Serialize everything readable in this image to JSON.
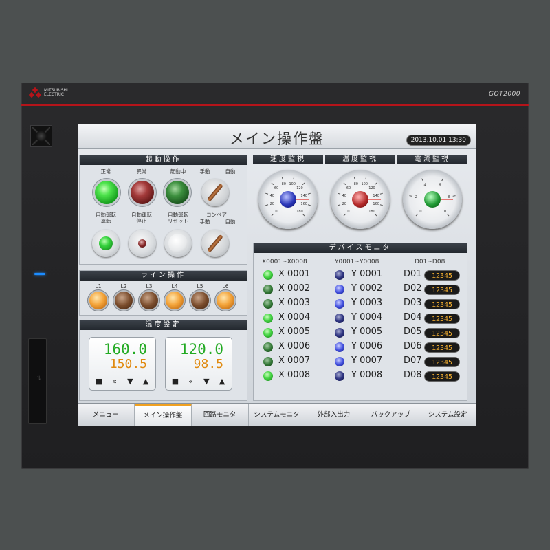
{
  "device": {
    "brand_line1": "MITSUBISHI",
    "brand_line2": "ELECTRIC",
    "model": "GOT2000",
    "accent": "#b5141a"
  },
  "screen": {
    "title": "メイン操作盤",
    "datetime": "2013.10.01 13:30"
  },
  "startup_panel": {
    "header": "起動操作",
    "row1_labels": [
      "正常",
      "異常",
      "起動中",
      "手動",
      "自動"
    ],
    "row2_labels": [
      "自動運転\n運転",
      "自動運転\n停止",
      "自動運転\nリセット",
      "コンベア"
    ],
    "row2_sub": [
      "手動",
      "自動"
    ]
  },
  "line_panel": {
    "header": "ライン操作",
    "labels": [
      "L1",
      "L2",
      "L3",
      "L4",
      "L5",
      "L6"
    ],
    "states": [
      "on",
      "off",
      "off",
      "on",
      "off",
      "on"
    ]
  },
  "temp_panel": {
    "header": "温度設定",
    "boxes": [
      {
        "setpoint": "160.0",
        "actual": "150.5"
      },
      {
        "setpoint": "120.0",
        "actual": "98.5"
      }
    ],
    "buttons": [
      "■",
      "«",
      "▼",
      "▲"
    ]
  },
  "gauges": [
    {
      "header": "速度監視",
      "color": "blue",
      "ticks": [
        "0",
        "20",
        "40",
        "60",
        "80",
        "100",
        "120",
        "140",
        "160",
        "180"
      ]
    },
    {
      "header": "温度監視",
      "color": "red",
      "ticks": [
        "0",
        "20",
        "40",
        "60",
        "80",
        "100",
        "120",
        "140",
        "160",
        "180"
      ]
    },
    {
      "header": "電流監視",
      "color": "green",
      "ticks": [
        "0",
        "2",
        "4",
        "6",
        "8",
        "10"
      ]
    }
  ],
  "monitor": {
    "header": "デバイスモニタ",
    "col_x": "X0001~X0008",
    "col_y": "Y0001~Y0008",
    "col_d": "D01~D08",
    "rows": [
      {
        "x": "X 0001",
        "x_on": true,
        "y": "Y 0001",
        "y_on": false,
        "d": "D01",
        "dv": "12345"
      },
      {
        "x": "X 0002",
        "x_on": false,
        "y": "Y 0002",
        "y_on": true,
        "d": "D02",
        "dv": "12345"
      },
      {
        "x": "X 0003",
        "x_on": false,
        "y": "Y 0003",
        "y_on": true,
        "d": "D03",
        "dv": "12345"
      },
      {
        "x": "X 0004",
        "x_on": true,
        "y": "Y 0004",
        "y_on": false,
        "d": "D04",
        "dv": "12345"
      },
      {
        "x": "X 0005",
        "x_on": true,
        "y": "Y 0005",
        "y_on": false,
        "d": "D05",
        "dv": "12345"
      },
      {
        "x": "X 0006",
        "x_on": false,
        "y": "Y 0006",
        "y_on": true,
        "d": "D06",
        "dv": "12345"
      },
      {
        "x": "X 0007",
        "x_on": false,
        "y": "Y 0007",
        "y_on": true,
        "d": "D07",
        "dv": "12345"
      },
      {
        "x": "X 0008",
        "x_on": true,
        "y": "Y 0008",
        "y_on": false,
        "d": "D08",
        "dv": "12345"
      }
    ]
  },
  "tabs": [
    {
      "label": "メニュー",
      "active": false
    },
    {
      "label": "メイン操作盤",
      "active": true
    },
    {
      "label": "回路モニタ",
      "active": false
    },
    {
      "label": "システムモニタ",
      "active": false
    },
    {
      "label": "外部入出力",
      "active": false
    },
    {
      "label": "バックアップ",
      "active": false
    },
    {
      "label": "システム設定",
      "active": false
    }
  ]
}
